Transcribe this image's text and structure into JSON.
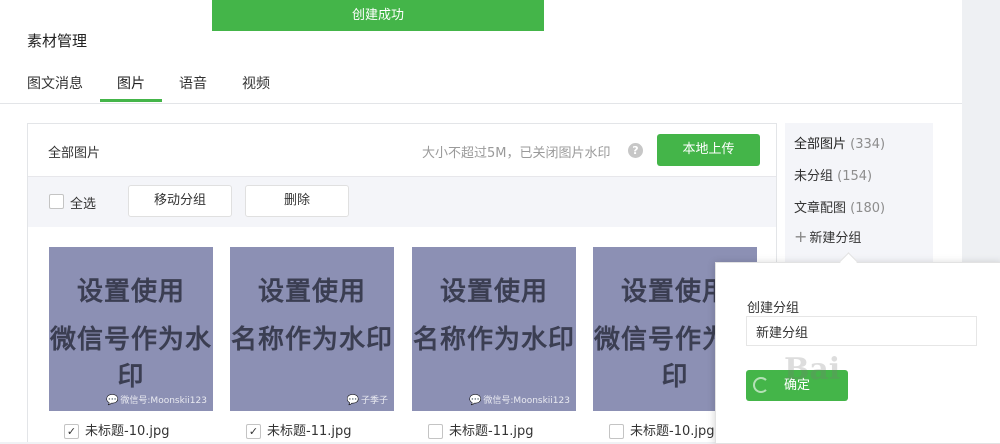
{
  "toast": {
    "text": "创建成功"
  },
  "page": {
    "title": "素材管理"
  },
  "tabs": [
    {
      "label": "图文消息",
      "active": false
    },
    {
      "label": "图片",
      "active": true
    },
    {
      "label": "语音",
      "active": false
    },
    {
      "label": "视频",
      "active": false
    }
  ],
  "main": {
    "title": "全部图片",
    "hint": "大小不超过5M，已关闭图片水印",
    "help_icon": "help-circle-icon",
    "upload_label": "本地上传",
    "toolbar": {
      "select_all_label": "全选",
      "move_group_label": "移动分组",
      "delete_label": "删除"
    },
    "images": [
      {
        "line1": "设置使用",
        "line2": "微信号作为水印",
        "watermark": "微信号:Moonskii123",
        "watermark_icon": "wechat-icon",
        "filename": "未标题-10.jpg",
        "checked": true,
        "check": "✓"
      },
      {
        "line1": "设置使用",
        "line2": "名称作为水印",
        "watermark": "子季子",
        "watermark_icon": "wechat-icon",
        "filename": "未标题-11.jpg",
        "checked": true,
        "check": "✓"
      },
      {
        "line1": "设置使用",
        "line2": "名称作为水印",
        "watermark": "微信号:Moonskii123",
        "watermark_icon": "wechat-icon",
        "filename": "未标题-11.jpg",
        "checked": false,
        "check": ""
      },
      {
        "line1": "设置使用",
        "line2": "微信号作为水印",
        "watermark": "",
        "watermark_icon": "",
        "filename": "未标题-10.jpg",
        "checked": false,
        "check": ""
      }
    ]
  },
  "sidebar": {
    "items": [
      {
        "label": "全部图片",
        "count": "(334)",
        "active": true
      },
      {
        "label": "未分组",
        "count": "(154)",
        "active": false
      },
      {
        "label": "文章配图",
        "count": "(180)",
        "active": false
      }
    ],
    "new_group_label": "新建分组",
    "new_group_icon": "plus-icon"
  },
  "popover": {
    "label": "创建分组",
    "input_value": "新建分组",
    "confirm_label": "确定"
  },
  "colors": {
    "accent": "#44b549",
    "thumb_bg": "#8c90b4"
  }
}
